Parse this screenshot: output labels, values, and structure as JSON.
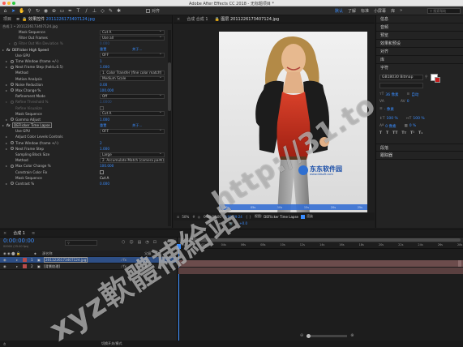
{
  "window": {
    "title": "Adobe After Effects CC 2018 - 无标题项目 *"
  },
  "toolbar": {
    "tools": [
      "select-icon",
      "hand-icon",
      "zoom-icon",
      "rotate-icon",
      "camera-icon",
      "pan-behind-icon",
      "rect-mask-icon",
      "pen-icon",
      "type-icon",
      "brush-icon",
      "clone-icon",
      "eraser-icon",
      "roto-icon",
      "puppet-icon"
    ],
    "align_label": "对齐",
    "workspaces": [
      "默认",
      "了解",
      "标准",
      "小屏幕",
      "库"
    ],
    "search_placeholder": "搜索帮助"
  },
  "left_panel": {
    "tabs": [
      "项目",
      "效果控件",
      "2011226173407124.jpg"
    ],
    "breadcrumb": "合成 1 • 2011226173407124.jpg",
    "rows": [
      {
        "indent": 2,
        "label": "Mask Sequence",
        "type": "dropdown",
        "value": "Cut A",
        "stopwatch": false,
        "twirl": false
      },
      {
        "indent": 2,
        "label": "Filter Out Frames",
        "type": "dropdown",
        "value": "Use all",
        "stopwatch": false,
        "twirl": false
      },
      {
        "indent": 2,
        "label": "Filter Out Min Deviation %",
        "type": "text",
        "value": "0.000",
        "stopwatch": true,
        "twirl": true,
        "dim": true
      },
      {
        "indent": 0,
        "label": "DEFlicker High Speed",
        "type": "links",
        "value": "重置",
        "value2": "关于...",
        "fx": true,
        "twirl": true
      },
      {
        "indent": 1,
        "label": "Use GPU",
        "type": "dropdown",
        "value": "OFF",
        "stopwatch": false,
        "twirl": false
      },
      {
        "indent": 1,
        "label": "Time Window (frame +/-)",
        "type": "text",
        "value": "1",
        "stopwatch": true,
        "twirl": true
      },
      {
        "indent": 1,
        "label": "Next Frame Step (hold=0.5)",
        "type": "text",
        "value": "1.000",
        "stopwatch": true,
        "twirl": true
      },
      {
        "indent": 1,
        "label": "Method",
        "type": "dropdown",
        "value": "1. Color Transfer (fine color match)",
        "stopwatch": false,
        "twirl": false
      },
      {
        "indent": 1,
        "label": "Motion Analysis",
        "type": "dropdown",
        "value": "Medium Scale",
        "stopwatch": false,
        "twirl": false
      },
      {
        "indent": 1,
        "label": "Noise Reduction",
        "type": "text",
        "value": "0.00",
        "stopwatch": true,
        "twirl": true
      },
      {
        "indent": 1,
        "label": "Max Change %",
        "type": "text",
        "value": "100.000",
        "stopwatch": true,
        "twirl": true
      },
      {
        "indent": 1,
        "label": "Refinement Mode",
        "type": "dropdown",
        "value": "Off",
        "stopwatch": false,
        "twirl": false
      },
      {
        "indent": 1,
        "label": "Refine Threshold %",
        "type": "text",
        "value": "1.0000",
        "stopwatch": true,
        "twirl": true,
        "dim": true
      },
      {
        "indent": 1,
        "label": "Refine Visualize",
        "type": "checkbox",
        "value": "",
        "stopwatch": false,
        "twirl": false,
        "dim": true
      },
      {
        "indent": 1,
        "label": "Mask Sequence",
        "type": "dropdown",
        "value": "Cut A",
        "stopwatch": false,
        "twirl": false
      },
      {
        "indent": 1,
        "label": "Gamma Adjust",
        "type": "text",
        "value": "1.000",
        "stopwatch": true,
        "twirl": true
      },
      {
        "indent": 0,
        "label": "DEFlicker Time Lapse",
        "type": "links",
        "value": "重置",
        "value2": "关于...",
        "fx": true,
        "twirl": true,
        "boxed": true
      },
      {
        "indent": 1,
        "label": "Use GPU",
        "type": "dropdown",
        "value": "OFF",
        "stopwatch": false,
        "twirl": false
      },
      {
        "indent": 1,
        "label": "Adjust Color Levels Controls",
        "type": "none",
        "value": "",
        "stopwatch": false,
        "twirl": true
      },
      {
        "indent": 1,
        "label": "Time Window (frame +/-)",
        "type": "text",
        "value": "2",
        "stopwatch": true,
        "twirl": true
      },
      {
        "indent": 1,
        "label": "Next Frame Step",
        "type": "text",
        "value": "1.000",
        "stopwatch": true,
        "twirl": true
      },
      {
        "indent": 1,
        "label": "Sampling Block Size",
        "type": "dropdown",
        "value": "Large",
        "stopwatch": false,
        "twirl": false
      },
      {
        "indent": 1,
        "label": "Method",
        "type": "dropdown",
        "value": "2. Accumulate Match (camera pans)",
        "stopwatch": false,
        "twirl": false
      },
      {
        "indent": 1,
        "label": "Max Color Change %",
        "type": "text",
        "value": "100.000",
        "stopwatch": true,
        "twirl": true
      },
      {
        "indent": 1,
        "label": "Constrain Color Fix",
        "type": "checkbox",
        "value": "",
        "stopwatch": false,
        "twirl": false
      },
      {
        "indent": 1,
        "label": "Mask Sequence",
        "type": "text",
        "value": "Cut A",
        "stopwatch": false,
        "twirl": false
      },
      {
        "indent": 1,
        "label": "Contrast %",
        "type": "text",
        "value": "0.000",
        "stopwatch": true,
        "twirl": true
      }
    ]
  },
  "viewer": {
    "tabs": [
      "合成 合成 1",
      "图层 2011226173407124.jpg"
    ],
    "photo_logo": "东东软件园",
    "photo_logo_sub": "www.ddsoft.com",
    "ruler_marks": [
      "00s",
      "05s",
      "10s",
      "15s",
      "20s",
      "25s"
    ],
    "bar": {
      "zoom": "50%",
      "timecode_start": "0:00:00:00",
      "timecode_dur": "0:00:29:24",
      "offset": "+0.0",
      "view_label": "视图:",
      "effect_label": "DEFlicker Time Lapse",
      "render_label": "渲染"
    }
  },
  "right_panel": {
    "sections": [
      "信息",
      "音频",
      "预览",
      "效果和预设",
      "对齐",
      "库",
      "字符",
      "段落",
      "跟踪器"
    ],
    "character": {
      "font_name": "GB18030 Bitmap",
      "size": "36 像素",
      "leading": "自动",
      "tracking": "0",
      "stroke": "- 像素",
      "vscale": "100 %",
      "hscale": "100 %",
      "baseline": "0 像素",
      "tsume": "0 %"
    }
  },
  "timeline": {
    "tab": "合成 1",
    "timecode": "0:00:00:00",
    "fps_note": "00000 (25.00 fps)",
    "columns": [
      "源名称",
      "父级"
    ],
    "layers": [
      {
        "num": "1",
        "name": "2011226173407124.jpg",
        "parent": "无",
        "color": "#b84b4b",
        "selected": true
      },
      {
        "num": "2",
        "name": "[背景纹理]",
        "parent": "无",
        "color": "#b84b4b",
        "selected": false
      }
    ],
    "ruler": [
      "0s",
      "02s",
      "04s",
      "06s",
      "08s",
      "10s",
      "12s",
      "14s",
      "16s",
      "18s",
      "20s",
      "22s",
      "24s",
      "26s",
      "28s"
    ],
    "toggle_label": "切换开关/模式"
  },
  "watermarks": {
    "url": "http://31.to",
    "brand": "xyz軟體補給站"
  },
  "colors": {
    "accent": "#3a8dff",
    "panel": "#232323",
    "selected_layer": "#2e4f86",
    "label_red": "#b84b4b",
    "dress": "#c8311f"
  }
}
